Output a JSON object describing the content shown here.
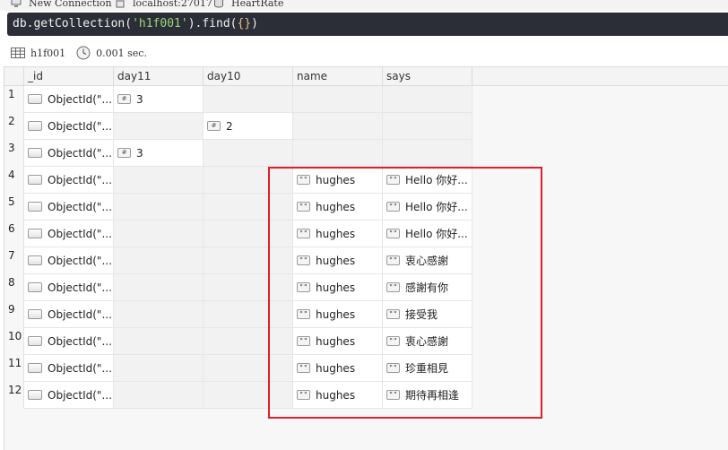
{
  "breadcrumb": {
    "connection": "New Connection",
    "server": "localhost:27017",
    "database": "HeartRate"
  },
  "query": {
    "prefix": "db.getCollection(",
    "collection_literal": "'h1f001'",
    "suffix": ").find(",
    "braces": "{}",
    "close": ")"
  },
  "result": {
    "collection": "h1f001",
    "time": "0.001 sec."
  },
  "columns": [
    "_id",
    "day11",
    "day10",
    "name",
    "says"
  ],
  "rows": [
    {
      "n": "1",
      "id": "ObjectId(\"...",
      "day11": "3",
      "day10": "",
      "name": "",
      "says": ""
    },
    {
      "n": "2",
      "id": "ObjectId(\"...",
      "day11": "",
      "day10": "2",
      "name": "",
      "says": ""
    },
    {
      "n": "3",
      "id": "ObjectId(\"...",
      "day11": "3",
      "day10": "",
      "name": "",
      "says": ""
    },
    {
      "n": "4",
      "id": "ObjectId(\"...",
      "day11": "",
      "day10": "",
      "name": "hughes",
      "says": "Hello 你好..."
    },
    {
      "n": "5",
      "id": "ObjectId(\"...",
      "day11": "",
      "day10": "",
      "name": "hughes",
      "says": "Hello 你好..."
    },
    {
      "n": "6",
      "id": "ObjectId(\"...",
      "day11": "",
      "day10": "",
      "name": "hughes",
      "says": "Hello 你好..."
    },
    {
      "n": "7",
      "id": "ObjectId(\"...",
      "day11": "",
      "day10": "",
      "name": "hughes",
      "says": "衷心感謝"
    },
    {
      "n": "8",
      "id": "ObjectId(\"...",
      "day11": "",
      "day10": "",
      "name": "hughes",
      "says": "感謝有你"
    },
    {
      "n": "9",
      "id": "ObjectId(\"...",
      "day11": "",
      "day10": "",
      "name": "hughes",
      "says": "接受我"
    },
    {
      "n": "10",
      "id": "ObjectId(\"...",
      "day11": "",
      "day10": "",
      "name": "hughes",
      "says": "衷心感謝"
    },
    {
      "n": "11",
      "id": "ObjectId(\"...",
      "day11": "",
      "day10": "",
      "name": "hughes",
      "says": "珍重相見"
    },
    {
      "n": "12",
      "id": "ObjectId(\"...",
      "day11": "",
      "day10": "",
      "name": "hughes",
      "says": "期待再相逢"
    }
  ],
  "icons": {
    "num_glyph": "#",
    "str_glyph": "\"\"",
    "highlight_color": "#e0202a"
  }
}
